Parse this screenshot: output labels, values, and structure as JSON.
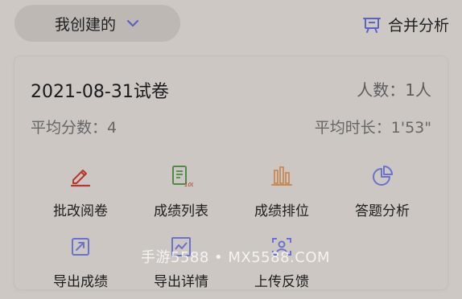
{
  "header": {
    "filter_label": "我创建的",
    "merge_label": "合并分析"
  },
  "card": {
    "title": "2021-08-31试卷",
    "people": "人数：1人",
    "avg_score": "平均分数：4",
    "avg_time": "平均时长：1'53\""
  },
  "actions": [
    {
      "label": "批改阅卷",
      "icon": "pencil-icon",
      "color": "#b5372f"
    },
    {
      "label": "成绩列表",
      "icon": "score-list-icon",
      "color": "#4f8a48"
    },
    {
      "label": "成绩排位",
      "icon": "bar-chart-icon",
      "color": "#c58a55"
    },
    {
      "label": "答题分析",
      "icon": "pie-chart-icon",
      "color": "#6b72c9"
    },
    {
      "label": "导出成绩",
      "icon": "export-icon",
      "color": "#6b72c9"
    },
    {
      "label": "导出详情",
      "icon": "chart-doc-icon",
      "color": "#6b72c9"
    },
    {
      "label": "上传反馈",
      "icon": "scan-user-icon",
      "color": "#6b72c9"
    }
  ],
  "watermark": "手游5588 • MX5588.COM",
  "colors": {
    "accent": "#5a64c4",
    "background": "#cdc8c4"
  }
}
